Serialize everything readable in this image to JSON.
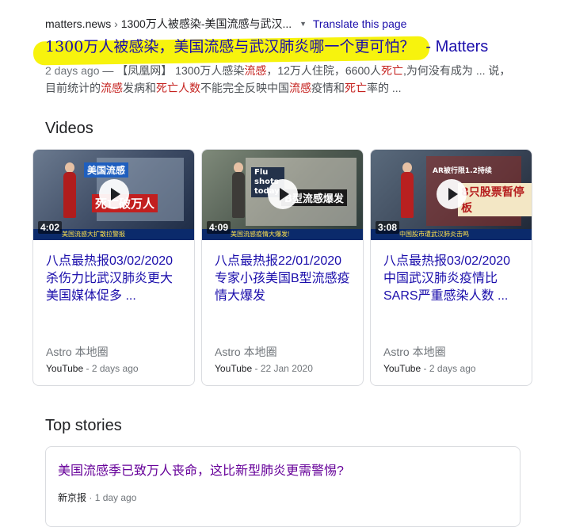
{
  "result": {
    "cite": "matters.news",
    "cite_sep": " › ",
    "cite_path": "1300万人被感染-美国流感与武汉...",
    "translate": "Translate this page",
    "title": "1300万人被感染，美国流感与武汉肺炎哪一个更可怕？",
    "site": "- Matters",
    "snippet": {
      "date": "2 days ago",
      "dash": " — ",
      "p1": "【凤凰网】 1300万人感染",
      "em1": "流感",
      "p2": "，12万人住院，6600人",
      "em2": "死亡",
      "p3": ",为何没有成为 ... 说，目前统计的",
      "em3": "流感",
      "p4": "发病和",
      "em4": "死亡人数",
      "p5": "不能完全反映中国",
      "em5": "流感",
      "p6": "疫情和",
      "em6": "死亡",
      "p7": "率的 ..."
    }
  },
  "videos_heading": "Videos",
  "videos": [
    {
      "duration": "4:02",
      "title": "八点最热报03/02/2020 杀伤力比武汉肺炎更大 美国媒体促多 ...",
      "channel": "Astro 本地圈",
      "source": "YouTube",
      "dash": " - ",
      "age": "2 days ago",
      "overlay_a": "美国流感",
      "overlay_b": "死亡破万人",
      "ticker": "美国流感大扩散拉警报"
    },
    {
      "duration": "4:09",
      "title": "八点最热报22/01/2020 专家小孩美国B型流感疫情大爆发",
      "channel": "Astro 本地圈",
      "source": "YouTube",
      "dash": " - ",
      "age": "22 Jan 2020",
      "overlay_a": "Flu shots today",
      "overlay_b": "B型流感爆发",
      "ticker": "美国流感疫情大爆发!"
    },
    {
      "duration": "3:08",
      "title": "八点最热报03/02/2020 中国武汉肺炎疫情比SARS严重感染人数 ...",
      "channel": "Astro 本地圈",
      "source": "YouTube",
      "dash": " - ",
      "age": "2 days ago",
      "overlay_a": "AR被行限1.2持续",
      "overlay_b": "8只股票暂停板",
      "ticker": "中国股市遭武汉肺炎击鸣"
    }
  ],
  "stories_heading": "Top stories",
  "story": {
    "title": "美国流感季已致万人丧命，这比新型肺炎更需警惕?",
    "source": "新京报",
    "dash": " · ",
    "age": "1 day ago"
  },
  "colors": {
    "link": "#1a0dab",
    "visited": "#660099",
    "highlight": "#f7f200",
    "emphasis": "#c5221f"
  }
}
